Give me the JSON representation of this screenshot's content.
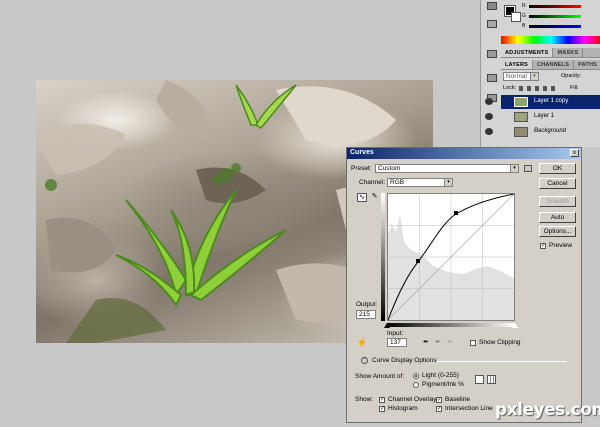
{
  "colors": {
    "canvas_bg": "#c8c8c8",
    "dialog_bg": "#d4d0c8",
    "title_bar": "#0a246a",
    "selected_layer": "#0a246a",
    "curve": "#000000"
  },
  "color_panel": {
    "channels": [
      "R",
      "G",
      "B"
    ]
  },
  "adjust_tabs": [
    "ADJUSTMENTS",
    "MASKS"
  ],
  "layers_panel": {
    "tabs": [
      "LAYERS",
      "CHANNELS",
      "PATHS"
    ],
    "blend_mode": "Normal",
    "opacity_label": "Opacity:",
    "lock_label": "Lock:",
    "fill_label": "Fill:",
    "layers": [
      {
        "name": "Layer 1 copy",
        "selected": true
      },
      {
        "name": "Layer 1",
        "selected": false
      },
      {
        "name": "Background",
        "selected": false,
        "italic": true
      }
    ]
  },
  "curves_dialog": {
    "title": "Curves",
    "close_glyph": "x",
    "preset_label": "Preset:",
    "preset_value": "Custom",
    "channel_label": "Channel:",
    "channel_value": "RGB",
    "buttons": {
      "ok": "OK",
      "cancel": "Cancel",
      "smooth": "Smooth",
      "auto": "Auto",
      "options": "Options..."
    },
    "preview_label": "Preview",
    "preview_checked": true,
    "output_label": "Output:",
    "output_value": "215",
    "input_label": "Input:",
    "input_value": "137",
    "show_clipping_label": "Show Clipping",
    "curve_display_label": "Curve Display Options",
    "show_amount_label": "Show Amount of:",
    "amount_options": [
      "Light  (0-255)",
      "Pigment/Ink %"
    ],
    "show_label": "Show:",
    "show_options": [
      "Channel Overlays",
      "Baseline",
      "Histogram",
      "Intersection Line"
    ]
  },
  "watermark": "pxleyes.com"
}
